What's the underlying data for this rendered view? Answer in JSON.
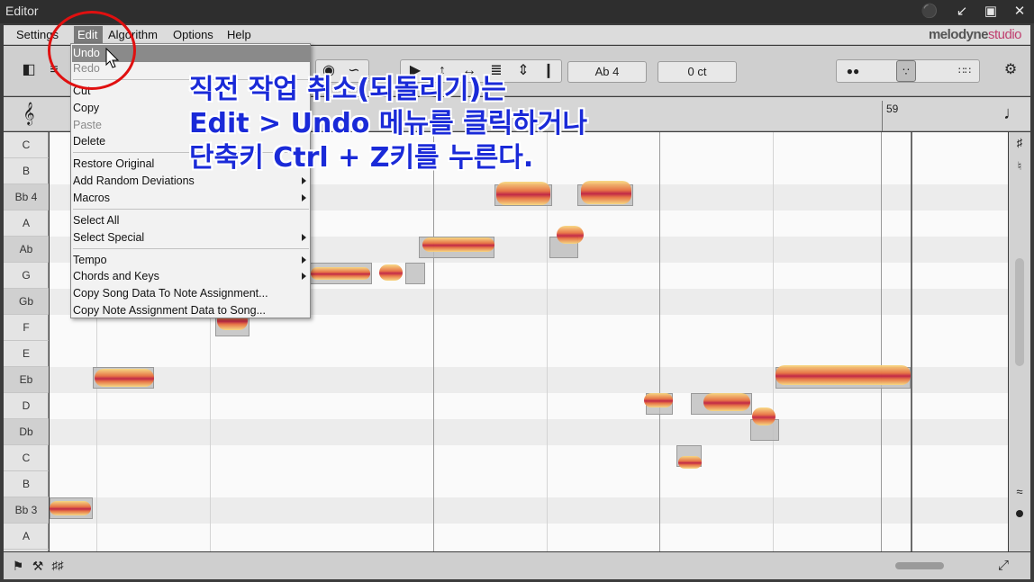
{
  "window": {
    "title": "Editor"
  },
  "menubar": {
    "items": [
      "Settings",
      "Edit",
      "Algorithm",
      "Options",
      "Help"
    ],
    "brand": "melodyne",
    "brand_suffix": "studio"
  },
  "toolbar": {
    "pitch_field": "Ab 4",
    "cents_field": "0 ct"
  },
  "ruler": {
    "bar_number": "59"
  },
  "keys": [
    "C",
    "B",
    "Bb 4",
    "A",
    "Ab",
    "G",
    "Gb",
    "F",
    "E",
    "Eb",
    "D",
    "Db",
    "C",
    "B",
    "Bb 3",
    "A"
  ],
  "edit_menu": {
    "undo": "Undo",
    "redo": "Redo",
    "cut": "Cut",
    "copy": "Copy",
    "paste": "Paste",
    "delete": "Delete",
    "restore_original": "Restore Original",
    "add_random_deviations": "Add Random Deviations",
    "macros": "Macros",
    "select_all": "Select All",
    "select_special": "Select Special",
    "tempo": "Tempo",
    "chords_and_keys": "Chords and Keys",
    "copy_song_data": "Copy Song Data To Note Assignment...",
    "copy_note_data": "Copy Note Assignment Data to Song..."
  },
  "annotation": {
    "line1": "직전 작업 취소(되돌리기)는",
    "line2": "Edit > Undo 메뉴를 클릭하거나",
    "line3": "단축키 Ctrl + Z키를 누른다."
  },
  "colors": {
    "highlight": "#8a8a8a",
    "annotation_text": "#1a2ad8",
    "circle": "#e01010"
  }
}
